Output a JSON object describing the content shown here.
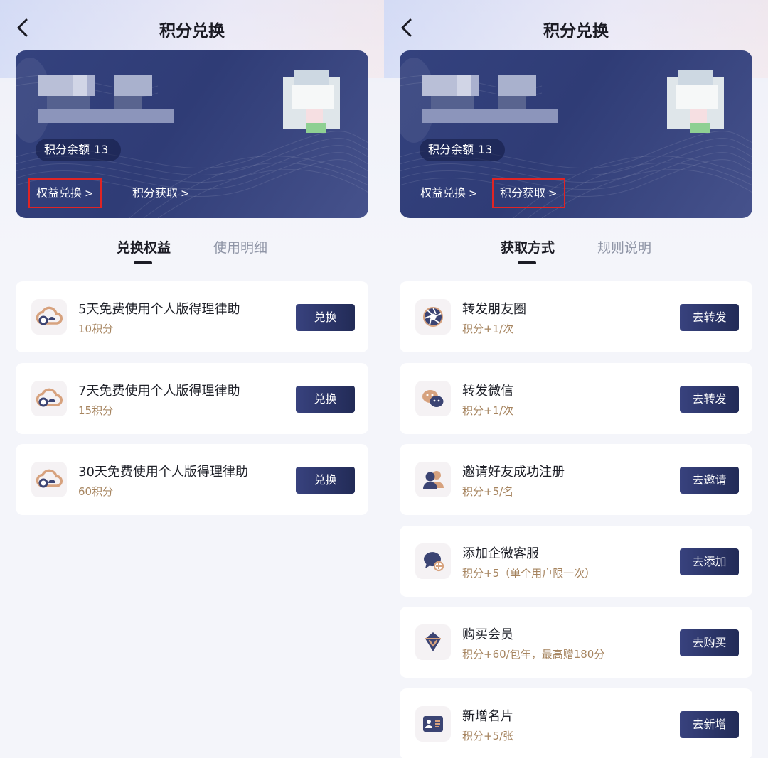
{
  "colors": {
    "card_bg": "#34427e",
    "button_bg": "#2c3669",
    "highlight_border": "#e02424",
    "points_text": "#a6845f",
    "title_text": "#1b1b24"
  },
  "left": {
    "title": "积分兑换",
    "balance_label": "积分余额",
    "balance_value": "13",
    "link_redeem": "权益兑换",
    "link_earn": "积分获取",
    "highlighted_link": "权益兑换",
    "tab_active": "兑换权益",
    "tab_inactive": "使用明细",
    "items": [
      {
        "icon": "cloud-icon",
        "title": "5天免费使用个人版得理律助",
        "points": "10积分",
        "button": "兑换"
      },
      {
        "icon": "cloud-icon",
        "title": "7天免费使用个人版得理律助",
        "points": "15积分",
        "button": "兑换"
      },
      {
        "icon": "cloud-icon",
        "title": "30天免费使用个人版得理律助",
        "points": "60积分",
        "button": "兑换"
      }
    ]
  },
  "right": {
    "title": "积分兑换",
    "balance_label": "积分余额",
    "balance_value": "13",
    "link_redeem": "权益兑换",
    "link_earn": "积分获取",
    "highlighted_link": "积分获取",
    "tab_active": "获取方式",
    "tab_inactive": "规则说明",
    "items": [
      {
        "icon": "camera-aperture-icon",
        "title": "转发朋友圈",
        "points": "积分+1/次",
        "button": "去转发"
      },
      {
        "icon": "wechat-icon",
        "title": "转发微信",
        "points": "积分+1/次",
        "button": "去转发"
      },
      {
        "icon": "invite-friends-icon",
        "title": "邀请好友成功注册",
        "points": "积分+5/名",
        "button": "去邀请"
      },
      {
        "icon": "customer-service-chat-icon",
        "title": "添加企微客服",
        "points": "积分+5（单个用户限一次）",
        "button": "去添加"
      },
      {
        "icon": "diamond-icon",
        "title": "购买会员",
        "points": "积分+60/包年，最高赠180分",
        "button": "去购买"
      },
      {
        "icon": "business-card-icon",
        "title": "新增名片",
        "points": "积分+5/张",
        "button": "去新增"
      }
    ]
  }
}
